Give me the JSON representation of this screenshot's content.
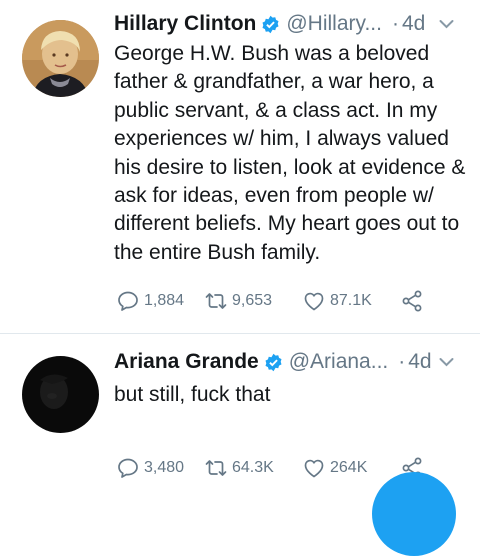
{
  "tweets": [
    {
      "name": "Hillary Clinton",
      "handle": "@Hillary...",
      "dot": "·",
      "time": "4d",
      "text": "George H.W. Bush was a beloved father & grandfather, a war hero, a public servant, & a class act. In my experiences w/ him, I always valued his desire to listen, look at evidence & ask for ideas, even from people w/ different beliefs. My heart goes out to the entire Bush family.",
      "replies": "1,884",
      "retweets": "9,653",
      "likes": "87.1K"
    },
    {
      "name": "Ariana Grande",
      "handle": "@Ariana...",
      "dot": "·",
      "time": "4d",
      "text": "but still, fuck that",
      "replies": "3,480",
      "retweets": "64.3K",
      "likes": "264K"
    }
  ],
  "icons": {
    "verified": "verified-badge-icon",
    "menu": "chevron-down-icon",
    "reply": "reply-icon",
    "retweet": "retweet-icon",
    "like": "heart-icon",
    "share": "share-icon"
  },
  "colors": {
    "accent": "#1da1f2",
    "text": "#14171a",
    "muted": "#657786",
    "divider": "#e1e8ed"
  }
}
